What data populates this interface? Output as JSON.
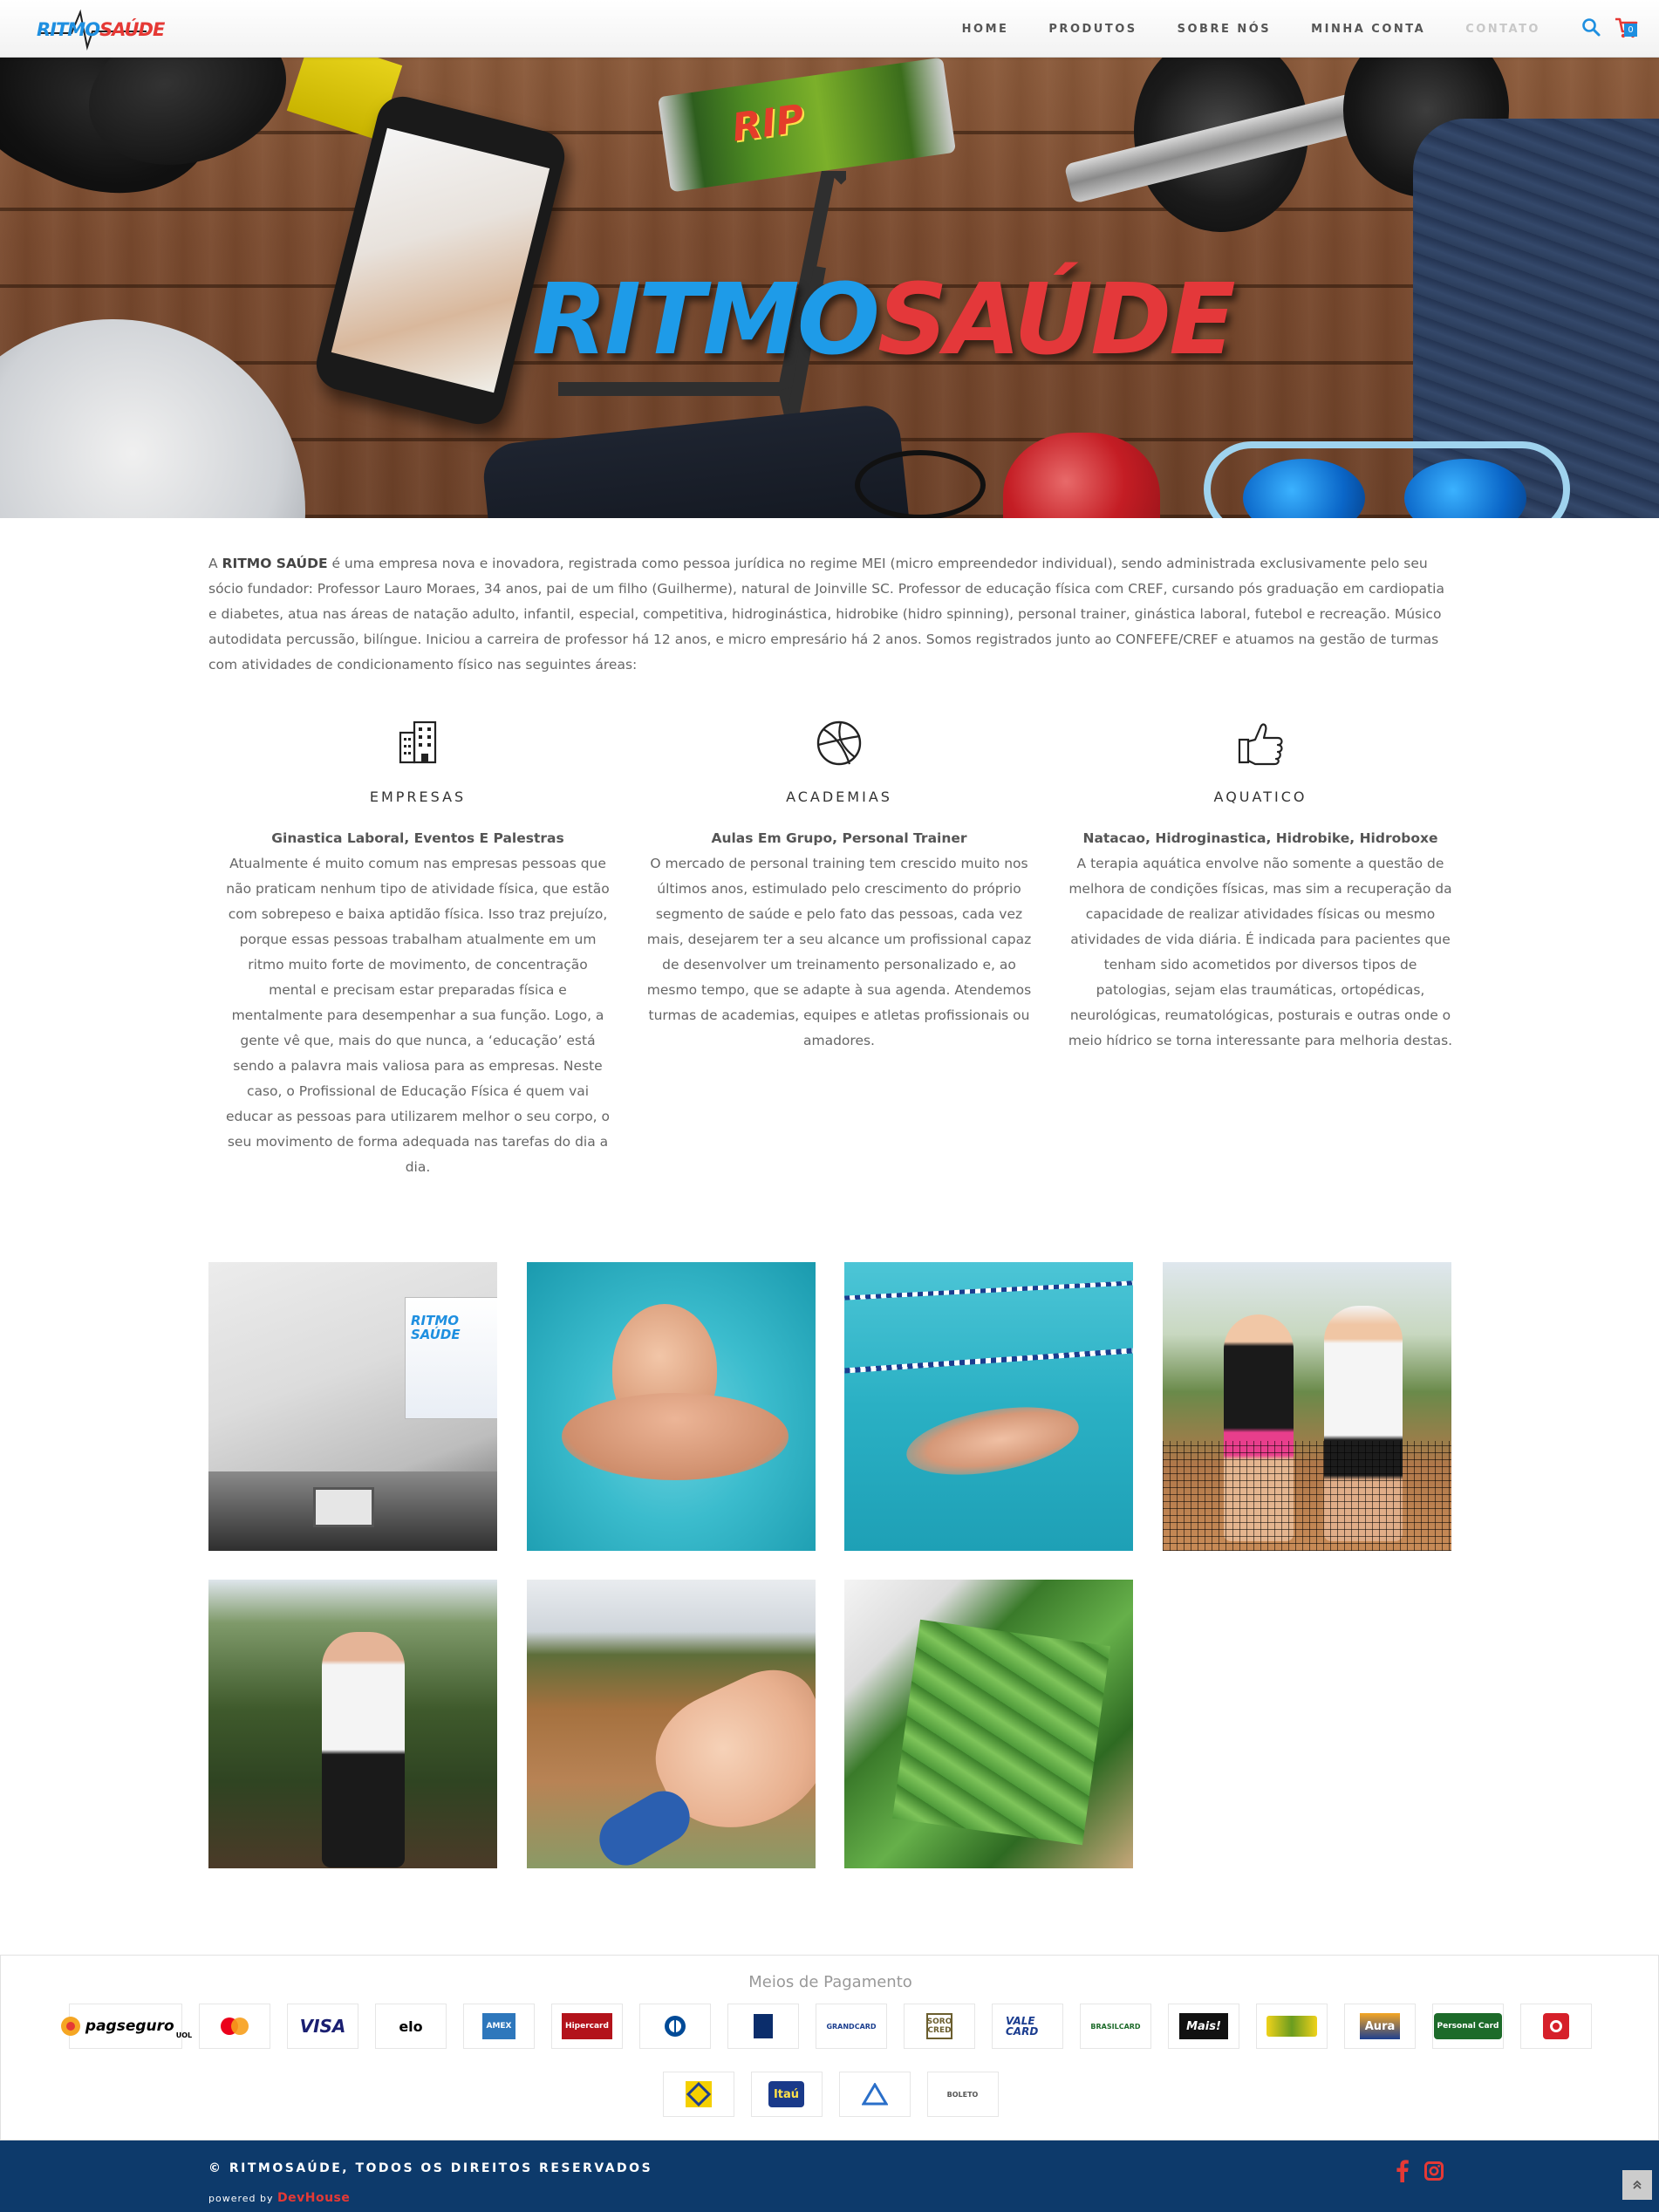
{
  "header": {
    "logo": {
      "part1": "RITMO",
      "part2": "SAÚDE"
    },
    "nav": [
      "HOME",
      "PRODUTOS",
      "SOBRE NÓS",
      "MINHA CONTA",
      "CONTATO"
    ],
    "cart_count": "0",
    "icons": [
      "search-icon",
      "cart-icon"
    ]
  },
  "hero": {
    "title_part1": "RITMO",
    "title_part2": "SAÚDE",
    "bar_wrapper_text": "RIP"
  },
  "intro": {
    "prefix": "A ",
    "company": "RITMO SAÚDE",
    "text": " é uma empresa nova e inovadora, registrada como pessoa jurídica no regime MEI (micro empreendedor individual), sendo administrada exclusivamente pelo seu sócio fundador: Professor Lauro Moraes, 34 anos, pai de um filho (Guilherme), natural de Joinville SC. Professor de educação física com CREF, cursando pós graduação em cardiopatia e diabetes, atua nas áreas de natação adulto, infantil, especial, competitiva, hidroginástica, hidrobike (hidro spinning), personal trainer, ginástica laboral, futebol e recreação. Músico autodidata percussão, bilíngue. Iniciou a carreira de professor há 12 anos, e micro empresário há 2 anos. Somos registrados junto ao CONFEFE/CREF e atuamos na gestão de turmas com atividades de condicionamento físico nas seguintes áreas:"
  },
  "features": [
    {
      "icon": "building-icon",
      "title": "EMPRESAS",
      "subtitle": "Ginastica Laboral, Eventos E Palestras",
      "text": "Atualmente é muito comum nas empresas pessoas que não praticam nenhum tipo de atividade física, que estão com sobrepeso e baixa aptidão física. Isso traz prejuízo, porque essas pessoas trabalham atualmente em um ritmo muito forte de movimento, de concentração mental e precisam estar preparadas física e mentalmente para desempenhar a sua função. Logo, a gente vê que, mais do que nunca, a ‘educação’ está sendo a palavra mais valiosa para as empresas. Neste caso, o Profissional de Educação Física é quem vai educar as pessoas para utilizarem melhor o seu corpo, o seu movimento de forma adequada nas tarefas do dia a dia."
    },
    {
      "icon": "basketball-icon",
      "title": "ACADEMIAS",
      "subtitle": "Aulas Em Grupo, Personal Trainer",
      "text": "O mercado de personal training tem crescido muito nos últimos anos, estimulado pelo crescimento do próprio segmento de saúde e pelo fato das pessoas, cada vez mais, desejarem ter a seu alcance um profissional capaz de desenvolver um treinamento personalizado e, ao mesmo tempo, que se adapte à sua agenda. Atendemos turmas de academias, equipes e atletas profissionais ou amadores."
    },
    {
      "icon": "thumbs-up-icon",
      "title": "AQUATICO",
      "subtitle": "Natacao, Hidroginastica, Hidrobike, Hidroboxe",
      "text": "A terapia aquática envolve não somente a questão de melhora de condições físicas, mas sim a recuperação da capacidade de realizar atividades físicas ou mesmo atividades de vida diária. É indicada para pacientes que tenham sido acometidos por diversos tipos de patologias, sejam elas traumáticas, ortopédicas, neurológicas, reumatológicas, posturais e outras onde o meio hídrico se torna interessante para melhoria destas."
    }
  ],
  "gallery": {
    "photos": [
      "office-photo",
      "swimmer-goggles-photo",
      "swimmer-freestyle-photo",
      "tennis-couple-photo",
      "trail-runner-photo",
      "motocross-snack-photo",
      "product-boxes-photo"
    ],
    "banner_text": "RITMO SAÚDE"
  },
  "payment": {
    "title": "Meios de Pagamento",
    "row1": [
      {
        "name": "pagseguro",
        "label": "pagseguro",
        "sub": "UOL",
        "color": "#000000"
      },
      {
        "name": "mastercard",
        "label": "",
        "color": "#eb001b"
      },
      {
        "name": "visa",
        "label": "VISA",
        "color": "#1a1f71"
      },
      {
        "name": "elo",
        "label": "elo",
        "color": "#000000"
      },
      {
        "name": "amex",
        "label": "AMEX",
        "color": "#2e77bc"
      },
      {
        "name": "hipercard",
        "label": "Hipercard",
        "color": "#b3131b"
      },
      {
        "name": "diners",
        "label": "",
        "color": "#004a97"
      },
      {
        "name": "aura-box",
        "label": "",
        "color": "#0b2d6b"
      },
      {
        "name": "grandcard",
        "label": "GRANDCARD",
        "color": "#1c3f8f"
      },
      {
        "name": "sorocred",
        "label": "SORO CRED",
        "color": "#6b5e2e"
      },
      {
        "name": "valecard",
        "label": "VALE CARD",
        "color": "#1a3c8f"
      },
      {
        "name": "brasilcard",
        "label": "BRASILCARD",
        "color": "#1d6b2a"
      },
      {
        "name": "mais",
        "label": "Mais!",
        "color": "#000000"
      },
      {
        "name": "cabal",
        "label": "",
        "color": "#6a9c1f"
      },
      {
        "name": "aura",
        "label": "Aura",
        "color": "#1d3f8f"
      },
      {
        "name": "personalcard",
        "label": "Personal Card",
        "color": "#1d6b2a"
      },
      {
        "name": "banrisul",
        "label": "",
        "color": "#d6202a"
      }
    ],
    "row2": [
      {
        "name": "banco-do-brasil",
        "label": "",
        "color": "#f5d000"
      },
      {
        "name": "itau",
        "label": "Itaú",
        "color": "#1a3a8a"
      },
      {
        "name": "bradesco-transfer",
        "label": "",
        "color": "#2a6fc9"
      },
      {
        "name": "boleto",
        "label": "BOLETO",
        "color": "#555555"
      }
    ]
  },
  "footer": {
    "copyright": "© RITMOSAÚDE, TODOS OS DIREITOS RESERVADOS",
    "powered_by": "powered by",
    "dev": "DevHouse",
    "icons": [
      "facebook-icon",
      "instagram-icon",
      "back-to-top-icon"
    ]
  },
  "colors": {
    "brand_blue": "#1e8fe0",
    "brand_red": "#e53935",
    "footer_bg": "#0d3a6b"
  }
}
